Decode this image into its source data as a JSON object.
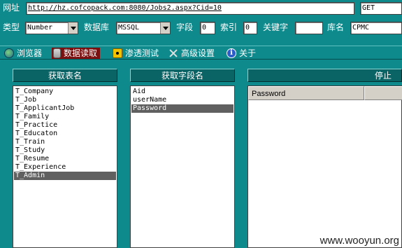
{
  "url_row": {
    "label": "网址",
    "url_value": "http://hz.cofcopack.com:8080/Jobs2.aspx?Cid=10",
    "method_value": "GET"
  },
  "options_row": {
    "type_label": "类型",
    "type_value": "Number",
    "db_label": "数据库",
    "db_value": "MSSQL",
    "field_label": "字段",
    "field_value": "0",
    "index_label": "索引",
    "index_value": "0",
    "keyword_label": "关键字",
    "keyword_value": "",
    "dbname_label": "库名",
    "dbname_value": "CPMC"
  },
  "tabs": [
    {
      "label": "浏览器",
      "icon": "globe-icon"
    },
    {
      "label": "数据读取",
      "icon": "database-icon",
      "active": true
    },
    {
      "label": "渗透测试",
      "icon": "radiation-icon"
    },
    {
      "label": "高级设置",
      "icon": "tools-icon"
    },
    {
      "label": "关于",
      "icon": "info-icon"
    }
  ],
  "tables_panel": {
    "header": "获取表名",
    "items": [
      "T_Company",
      "T_Job",
      "T_ApplicantJob",
      "T_Family",
      "T_Practice",
      "T_Educaton",
      "T_Train",
      "T_Study",
      "T_Resume",
      "T_Experience",
      "T_Admin"
    ],
    "selected": "T_Admin"
  },
  "fields_panel": {
    "header": "获取字段名",
    "items": [
      "Aid",
      "userName",
      "Password"
    ],
    "selected": "Password"
  },
  "result_panel": {
    "header": "停止",
    "columns": [
      "Password",
      ""
    ]
  },
  "watermark": "www.wooyun.org",
  "colors": {
    "background": "#0e8a8c",
    "active_tab": "#7a1010",
    "panel_header": "#0a6466",
    "selection": "#606060"
  }
}
